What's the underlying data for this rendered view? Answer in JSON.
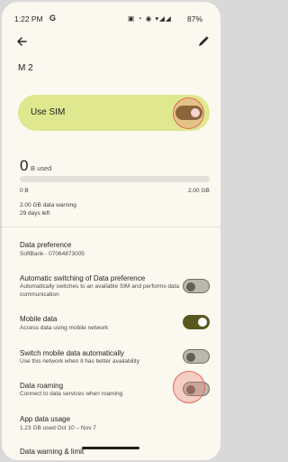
{
  "status_bar": {
    "time": "1:22 PM",
    "app_icon": "G",
    "icons": "▣ ◔ ◉ ▾◢◢",
    "battery": "87%"
  },
  "topbar": {
    "back_icon": "arrow-left",
    "edit_icon": "pencil"
  },
  "title": "M 2",
  "use_sim": {
    "label": "Use SIM",
    "enabled": true
  },
  "usage": {
    "amount": "0",
    "unit": "B used",
    "progress": 0,
    "min_label": "0 B",
    "max_label": "2.00 GB",
    "warning": "2.00 GB data warning",
    "days_left": "29 days left"
  },
  "settings": [
    {
      "title": "Data preference",
      "subtitle": "SoftBank - 07064873005"
    },
    {
      "title": "Automatic switching of Data preference",
      "subtitle": "Automatically switches to an available SIM and performs data communication",
      "toggle": false
    },
    {
      "title": "Mobile data",
      "subtitle": "Access data using mobile network",
      "toggle": true
    },
    {
      "title": "Switch mobile data automatically",
      "subtitle": "Use this network when it has better availability",
      "toggle": false
    },
    {
      "title": "Data roaming",
      "subtitle": "Connect to data services when roaming",
      "toggle": false
    },
    {
      "title": "App data usage",
      "subtitle": "1.23 GB used Oct 10 – Nov 7"
    },
    {
      "title": "Data warning & limit",
      "subtitle": ""
    }
  ],
  "colors": {
    "accent": "#58581e",
    "use_sim_bg": "#dfe78f",
    "background": "#fbf8ef",
    "tap_highlight": "#e06a5c"
  }
}
